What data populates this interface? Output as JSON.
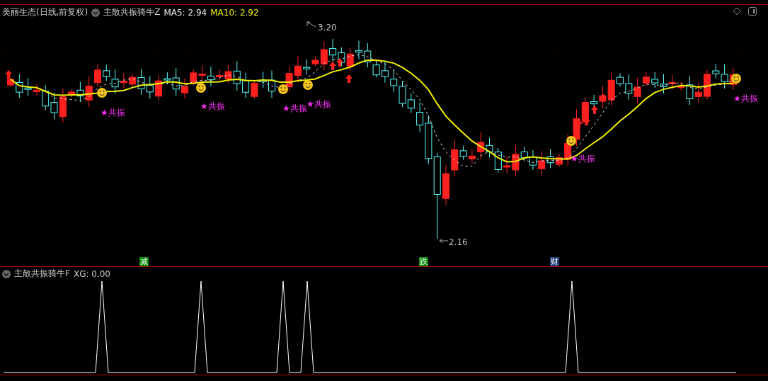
{
  "title": {
    "stock": "美丽生态(日线,前复权)",
    "indicator": "主散共振骑牛Z",
    "ma5": "MA5: 2.94",
    "ma10": "MA10: 2.92"
  },
  "price_labels": {
    "high": "3.20",
    "low": "2.16"
  },
  "signals": [
    {
      "label": "★共振"
    },
    {
      "label": "★共振"
    },
    {
      "label": "★共振"
    },
    {
      "label": "★共振"
    },
    {
      "label": "★共振"
    },
    {
      "label": "★共振"
    }
  ],
  "markers": [
    {
      "text": "减",
      "color": "#0a8a0a"
    },
    {
      "text": "跌",
      "color": "#0a8a0a"
    },
    {
      "text": "财",
      "color": "#1c3f78"
    }
  ],
  "sub_panel": {
    "indicator": "主散共振骑牛F",
    "xg": "XG: 0.00"
  }
}
